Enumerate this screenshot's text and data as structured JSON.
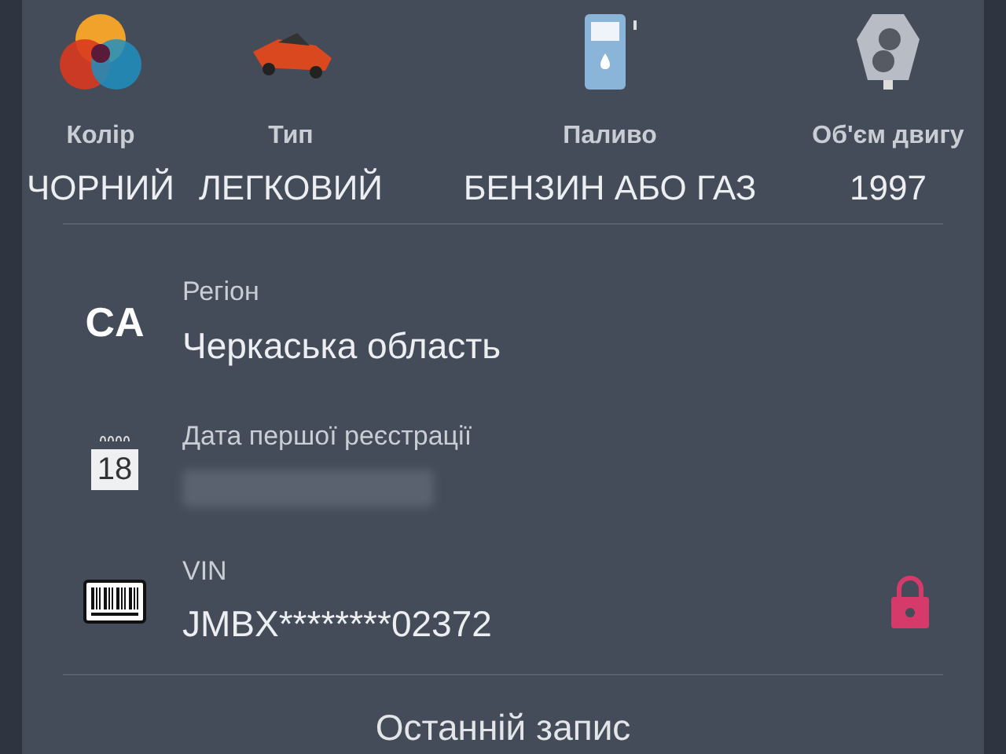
{
  "specs": [
    {
      "kind": "palette",
      "label": "Колір",
      "value": "ЧОРНИЙ"
    },
    {
      "kind": "car",
      "label": "Тип",
      "value": "ЛЕГКОВИЙ"
    },
    {
      "kind": "fuel",
      "label": "Паливо",
      "value": "БЕНЗИН АБО ГАЗ"
    },
    {
      "kind": "engine",
      "label": "Об'єм двигу",
      "value": "1997"
    }
  ],
  "details": [
    {
      "kind": "region",
      "badge": "CA",
      "label": "Регіон",
      "value": "Черкаська область",
      "locked": false
    },
    {
      "kind": "date",
      "badge": "18",
      "label": "Дата першої реєстрації",
      "redacted": true,
      "locked": false
    },
    {
      "kind": "vin",
      "label": "VIN",
      "value": "JMBX********02372",
      "locked": true
    }
  ],
  "footer": {
    "title": "Останній запис"
  }
}
